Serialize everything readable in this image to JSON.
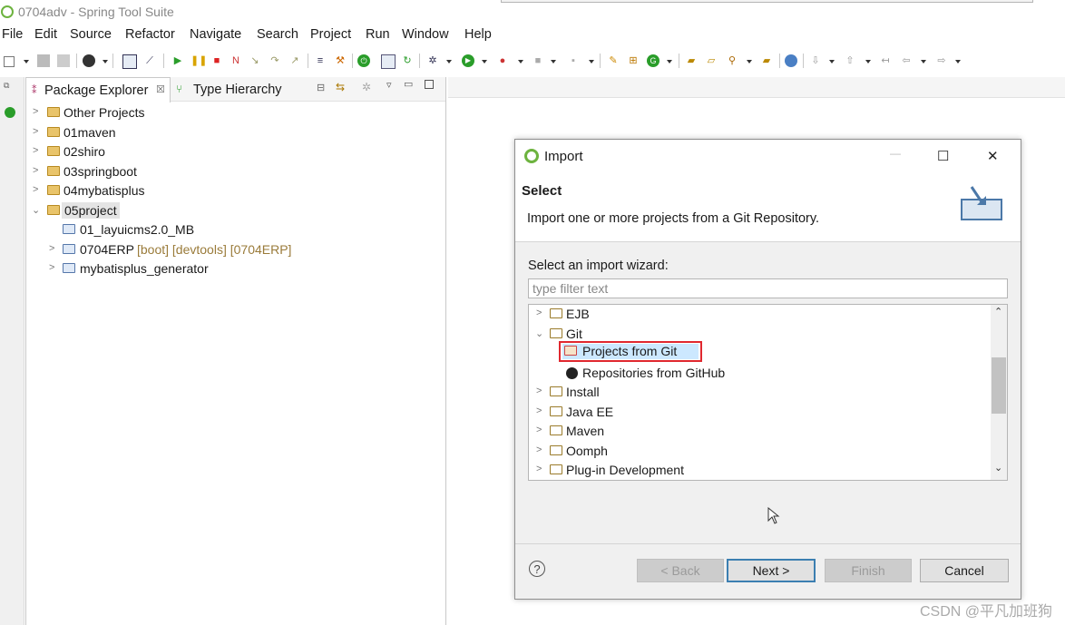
{
  "window": {
    "title": "0704adv - Spring Tool Suite"
  },
  "menu": [
    "File",
    "Edit",
    "Source",
    "Refactor",
    "Navigate",
    "Search",
    "Project",
    "Run",
    "Window",
    "Help"
  ],
  "toolbar_icons": [
    "new-icon",
    "save-icon",
    "save-all-icon",
    "profile-icon",
    "terminal-icon",
    "skip-breakpoints-icon",
    "resume-icon",
    "suspend-icon",
    "terminate-icon",
    "disconnect-icon",
    "step-into-icon",
    "step-over-icon",
    "step-return-icon",
    "servers-icon",
    "boot-dashboard-icon",
    "power-icon",
    "toggle-icon",
    "refresh-icon",
    "debug-icon",
    "run-icon",
    "external-tools-icon",
    "stop-icon",
    "build-icon",
    "new-java-icon",
    "new-package-icon",
    "new-class-icon",
    "open-type-icon",
    "open-task-icon",
    "search-icon",
    "pin-icon",
    "globe-icon",
    "next-annotation-icon",
    "prev-annotation-icon",
    "last-edit-icon",
    "back-icon",
    "forward-icon"
  ],
  "package_explorer": {
    "tab_label": "Package Explorer",
    "tab_close": "☒",
    "other_tab_label": "Type Hierarchy",
    "items": [
      {
        "label": "Other Projects",
        "expanded": false
      },
      {
        "label": "01maven",
        "expanded": false
      },
      {
        "label": "02shiro",
        "expanded": false
      },
      {
        "label": "03springboot",
        "expanded": false
      },
      {
        "label": "04mybatisplus",
        "expanded": false
      },
      {
        "label": "05project",
        "expanded": true
      },
      {
        "label": "01_layuicms2.0_MB"
      },
      {
        "label": "0704ERP",
        "decoration": "[boot] [devtools] [0704ERP]"
      },
      {
        "label": "mybatisplus_generator"
      }
    ]
  },
  "dialog": {
    "title": "Import",
    "heading": "Select",
    "description": "Import one or more projects from a Git Repository.",
    "wizard_label": "Select an import wizard:",
    "filter_placeholder": "type filter text",
    "wizards": [
      {
        "label": "EJB",
        "level": 0,
        "expanded": false
      },
      {
        "label": "Git",
        "level": 0,
        "expanded": true
      },
      {
        "label": "Projects from Git",
        "level": 1,
        "selected": true
      },
      {
        "label": "Repositories from GitHub",
        "level": 1
      },
      {
        "label": "Install",
        "level": 0,
        "expanded": false
      },
      {
        "label": "Java EE",
        "level": 0,
        "expanded": false
      },
      {
        "label": "Maven",
        "level": 0,
        "expanded": false
      },
      {
        "label": "Oomph",
        "level": 0,
        "expanded": false
      },
      {
        "label": "Plug-in Development",
        "level": 0,
        "expanded": false
      }
    ],
    "buttons": {
      "help": "?",
      "back": "< Back",
      "next": "Next >",
      "finish": "Finish",
      "cancel": "Cancel"
    },
    "window_controls": {
      "minimize": "—",
      "maximize": "☐",
      "close": "✕"
    }
  },
  "watermark": "CSDN @平凡加班狗",
  "colors": {
    "selection": "#cce8ff",
    "highlight_border": "#e0282f",
    "spring_green": "#6db33f"
  }
}
